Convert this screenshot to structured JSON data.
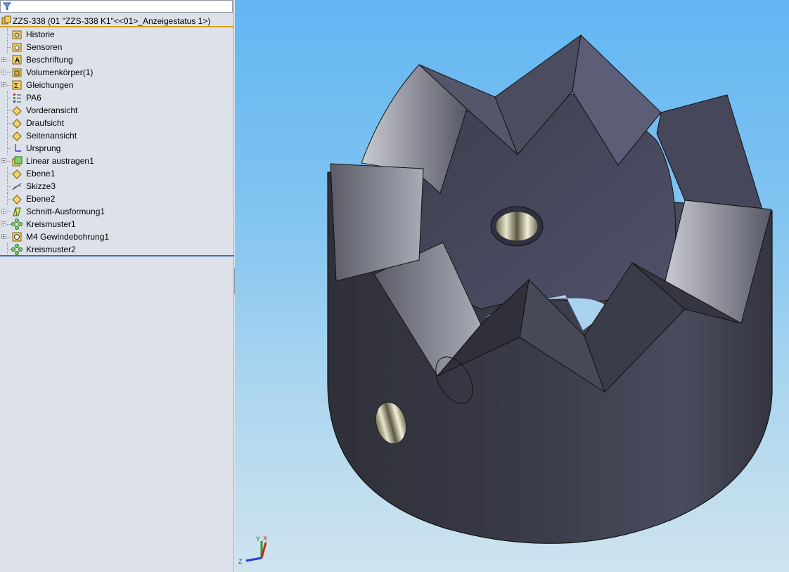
{
  "feature_tree": {
    "root_label": "ZZS-338  (01 \"ZZS-338 K1\"<<01>_Anzeigestatus 1>)",
    "items": [
      {
        "label": "Historie",
        "icon": "history-folder-icon",
        "expandable": false
      },
      {
        "label": "Sensoren",
        "icon": "sensor-folder-icon",
        "expandable": false
      },
      {
        "label": "Beschriftung",
        "icon": "annotation-folder-icon",
        "expandable": true
      },
      {
        "label": "Volumenkörper(1)",
        "icon": "solid-bodies-folder-icon",
        "expandable": true
      },
      {
        "label": "Gleichungen",
        "icon": "equations-folder-icon",
        "expandable": true
      },
      {
        "label": "PA6",
        "icon": "material-icon",
        "expandable": false
      },
      {
        "label": "Vorderansicht",
        "icon": "plane-icon",
        "expandable": false
      },
      {
        "label": "Draufsicht",
        "icon": "plane-icon",
        "expandable": false
      },
      {
        "label": "Seitenansicht",
        "icon": "plane-icon",
        "expandable": false
      },
      {
        "label": "Ursprung",
        "icon": "origin-icon",
        "expandable": false
      },
      {
        "label": "Linear austragen1",
        "icon": "extrude-icon",
        "expandable": true
      },
      {
        "label": "Ebene1",
        "icon": "plane-icon",
        "expandable": false
      },
      {
        "label": "Skizze3",
        "icon": "sketch-icon",
        "expandable": false
      },
      {
        "label": "Ebene2",
        "icon": "plane-icon",
        "expandable": false
      },
      {
        "label": "Schnitt-Ausformung1",
        "icon": "loft-cut-icon",
        "expandable": true
      },
      {
        "label": "Kreismuster1",
        "icon": "circular-pattern-icon",
        "expandable": true
      },
      {
        "label": "M4 Gewindebohrung1",
        "icon": "hole-wizard-icon",
        "expandable": true
      },
      {
        "label": "Kreismuster2",
        "icon": "circular-pattern-icon",
        "expandable": false
      }
    ]
  },
  "triad": {
    "x": "X",
    "y": "Y",
    "z": "Z"
  },
  "colors": {
    "panel_bg": "#dde2ea",
    "root_underline": "#d6a21e",
    "viewport_top": "#63b6f3",
    "viewport_bottom": "#cfe3ee",
    "part_body": "#3c3d4a"
  }
}
